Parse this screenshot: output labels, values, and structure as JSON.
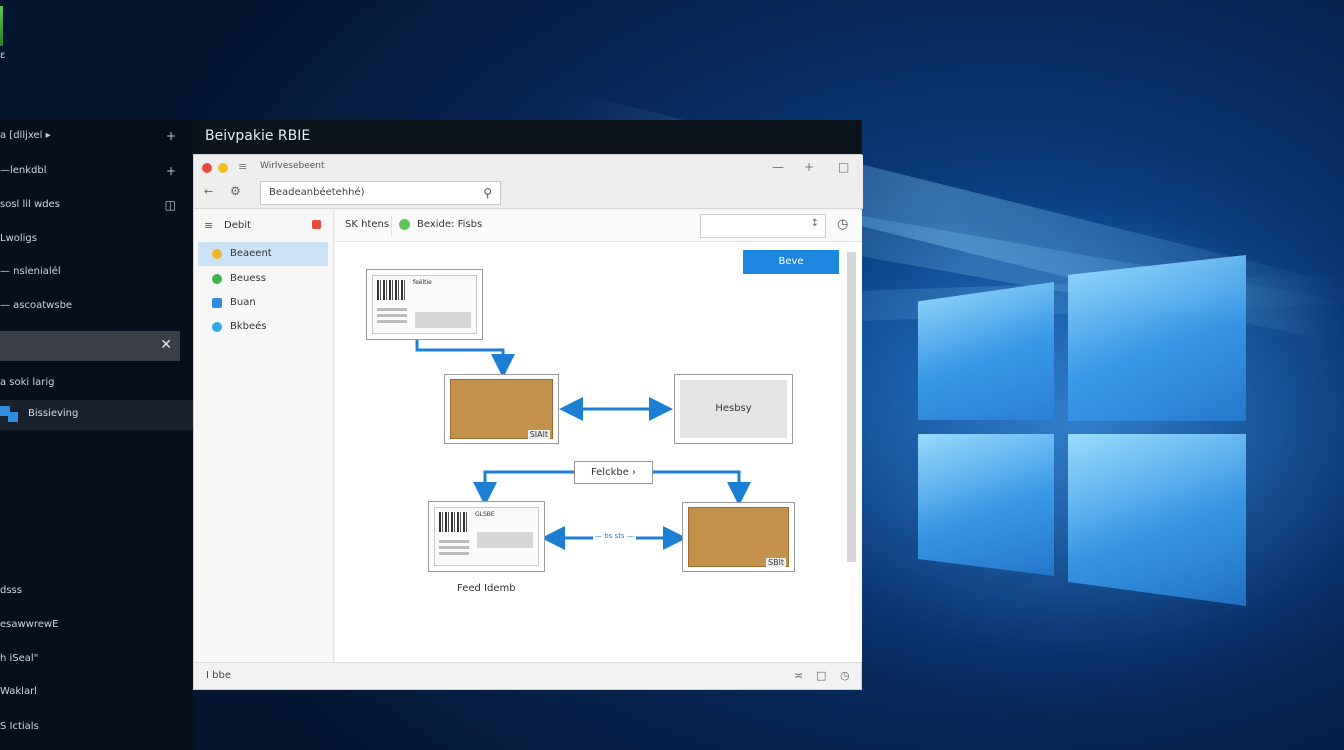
{
  "desktop": {
    "top_left_label": "ε",
    "accent": "#1d86e0"
  },
  "sidebar": {
    "items": [
      {
        "label": "a [dlljxel ▸",
        "icon": "plus-icon"
      },
      {
        "label": "—lenkdbl",
        "icon": "plus-icon"
      },
      {
        "label": "sosl lil wdes",
        "icon": "panel-icon"
      },
      {
        "label": "Lwoligs",
        "icon": ""
      },
      {
        "label": "— nslenialél",
        "icon": ""
      },
      {
        "label": "— ascoatwsbe",
        "icon": ""
      }
    ],
    "search_close": "✕",
    "section_label": "a soki larig",
    "active_item": "Bissieving",
    "bottom_items": [
      "dsss",
      "esawwrewE",
      "h iSeal\"",
      "Waklarl",
      "S Ictials"
    ]
  },
  "window": {
    "title": "Beivpakie RBIE",
    "chrome_tab": "Wirlvesebeent",
    "address": "Beadeanbéetehhé)",
    "nav": {
      "header": "Debit",
      "items": [
        {
          "label": "Beaeent",
          "color": "#f0b429"
        },
        {
          "label": "Beuess",
          "color": "#3bb54a"
        },
        {
          "label": "Buan",
          "color": "#2f8ee0"
        },
        {
          "label": "Bkbeés",
          "color": "#2fa8e8"
        }
      ]
    },
    "toolbar": {
      "left_text": "SK htens",
      "mid_text": "Bexide: Fisbs",
      "dropdown_arrow": "↕"
    },
    "primary_button": "Beve",
    "diagram": {
      "right_box_label": "Hesbsy",
      "branch_label": "Felckbe ›",
      "tag_1": "SIAlt",
      "tag_2": "SBlt",
      "dotted_label": "— bs sts —",
      "caption": "Feed Idemb",
      "card_1_title": "feéltie",
      "card_2_title": "GLSBE"
    },
    "status": "I bbe"
  }
}
